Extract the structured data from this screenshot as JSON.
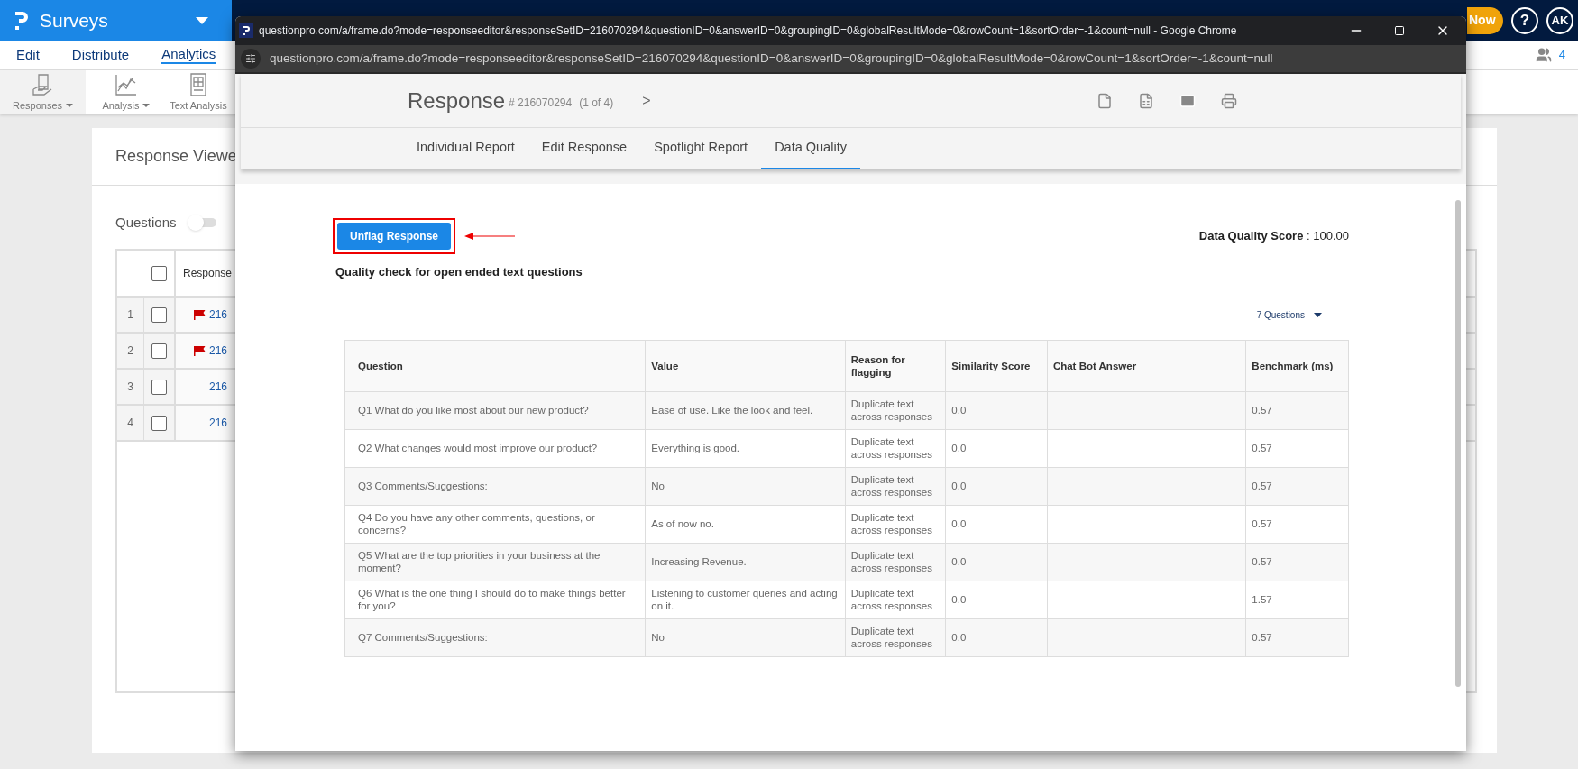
{
  "app": {
    "brand": "Surveys",
    "menu": [
      {
        "label": "Edit",
        "selected": false
      },
      {
        "label": "Distribute",
        "selected": false
      },
      {
        "label": "Analytics",
        "selected": true
      }
    ],
    "toolbar": [
      {
        "label": "Responses",
        "kind": "responses",
        "dropdown": true
      },
      {
        "label": "Analysis",
        "kind": "analysis",
        "dropdown": true
      },
      {
        "label": "Text Analysis",
        "kind": "text",
        "dropdown": false
      }
    ],
    "upgrade": "Now",
    "help": "?",
    "avatar": "AK",
    "participants": "4"
  },
  "viewer": {
    "title": "Response Viewe",
    "toggle": {
      "label": "Questions",
      "on": false
    },
    "column": "Response",
    "select_all_checked": false,
    "rows": [
      {
        "number": "1",
        "checked": false,
        "flagged": true,
        "id": "216"
      },
      {
        "number": "2",
        "checked": false,
        "flagged": true,
        "id": "216"
      },
      {
        "number": "3",
        "checked": false,
        "flagged": false,
        "id": "216"
      },
      {
        "number": "4",
        "checked": false,
        "flagged": false,
        "id": "216"
      }
    ]
  },
  "popup": {
    "window_title": "questionpro.com/a/frame.do?mode=responseeditor&responseSetID=216070294&questionID=0&answerID=0&groupingID=0&globalResultMode=0&rowCount=1&sortOrder=-1&count=null - Google Chrome",
    "url": "questionpro.com/a/frame.do?mode=responseeditor&responseSetID=216070294&questionID=0&answerID=0&groupingID=0&globalResultMode=0&rowCount=1&sortOrder=-1&count=null",
    "response": {
      "title": "Response",
      "number": "# 216070294",
      "position": "(1 of 4)",
      "next": ">"
    },
    "tabs": [
      {
        "label": "Individual Report",
        "selected": false
      },
      {
        "label": "Edit Response",
        "selected": false
      },
      {
        "label": "Spotlight Report",
        "selected": false
      },
      {
        "label": "Data Quality",
        "selected": true
      }
    ],
    "unflag_button": "Unflag Response",
    "score": "**Data Quality Score** : 100.00",
    "section_title": "Quality check for open ended text questions",
    "questions_filter": "7 Questions",
    "table": {
      "columns": [
        "Question",
        "Value",
        "Reason for flagging",
        "Similarity Score",
        "Chat Bot Answer",
        "Benchmark (ms)"
      ],
      "rows": [
        [
          "Q1 What do you like most about our new product?",
          "Ease of use. Like the look and feel.",
          "Duplicate text across responses",
          "0.0",
          "",
          "0.57"
        ],
        [
          "Q2 What changes would most improve our product?",
          "Everything is good.",
          "Duplicate text across responses",
          "0.0",
          "",
          "0.57"
        ],
        [
          "Q3 Comments/Suggestions:",
          "No",
          "Duplicate text across responses",
          "0.0",
          "",
          "0.57"
        ],
        [
          "Q4 Do you have any other comments, questions, or concerns?",
          "As of now no.",
          "Duplicate text across responses",
          "0.0",
          "",
          "0.57"
        ],
        [
          "Q5 What are the top priorities in your business at the moment?",
          "Increasing Revenue.",
          "Duplicate text across responses",
          "0.0",
          "",
          "0.57"
        ],
        [
          "Q6 What is the one thing I should do to make things better for you?",
          "Listening to customer queries and acting on it.",
          "Duplicate text across responses",
          "0.0",
          "",
          "1.57"
        ],
        [
          "Q7 Comments/Suggestions:",
          "No",
          "Duplicate text across responses",
          "0.0",
          "",
          "0.57"
        ]
      ]
    }
  }
}
